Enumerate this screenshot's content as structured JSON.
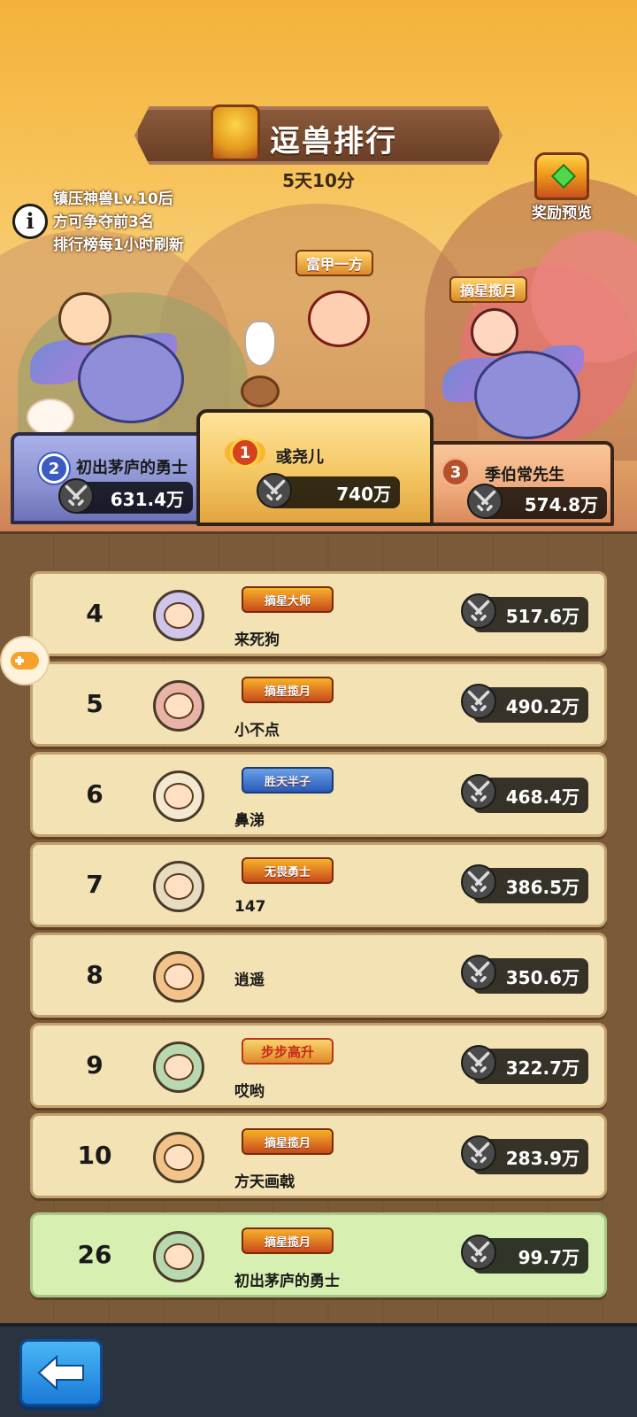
{
  "header": {
    "title": "逗兽排行",
    "timer": "5天10分",
    "rules": [
      "镇压神兽Lv.10后",
      "方可争夺前3名",
      "排行榜每1小时刷新"
    ],
    "reward_label": "奖励预览"
  },
  "top3": {
    "first": {
      "rank": "1",
      "name": "彧尧儿",
      "score": "740万",
      "title": "富甲一方"
    },
    "second": {
      "rank": "2",
      "name": "初出茅庐的勇士",
      "score": "631.4万"
    },
    "third": {
      "rank": "3",
      "name": "季伯常先生",
      "score": "574.8万",
      "title": "摘星揽月"
    }
  },
  "ranking": [
    {
      "rank": "4",
      "name": "来死狗",
      "title": "摘星大师",
      "score": "517.6万"
    },
    {
      "rank": "5",
      "name": "小不点",
      "title": "摘星揽月",
      "score": "490.2万"
    },
    {
      "rank": "6",
      "name": "鼻涕",
      "title": "胜天半子",
      "score": "468.4万"
    },
    {
      "rank": "7",
      "name": "147",
      "title": "无畏勇士",
      "score": "386.5万"
    },
    {
      "rank": "8",
      "name": "逍遥",
      "title": "",
      "score": "350.6万"
    },
    {
      "rank": "9",
      "name": "哎哟",
      "title": "步步高升",
      "score": "322.7万"
    },
    {
      "rank": "10",
      "name": "方天画戟",
      "title": "摘星揽月",
      "score": "283.9万"
    }
  ],
  "me": {
    "rank": "26",
    "name": "初出茅庐的勇士",
    "title": "摘星揽月",
    "score": "99.7万"
  },
  "icons": {
    "info": "info-icon",
    "reward": "treasure-chest-icon",
    "power": "crossed-swords-icon",
    "back": "back-arrow-icon",
    "float": "gamepad-icon"
  },
  "colors": {
    "row_bg": "#f3e2b3",
    "my_row_bg": "#d7f0b2",
    "panel_bg": "#7b5a39",
    "back_button": "#1a7ad8"
  }
}
